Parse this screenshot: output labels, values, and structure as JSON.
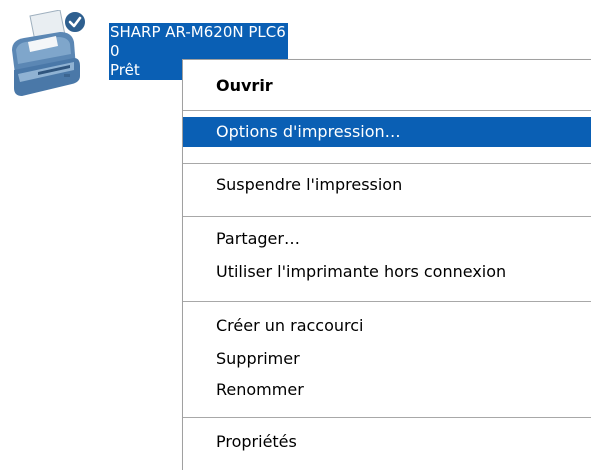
{
  "printer": {
    "name": "SHARP AR-M620N PLC6",
    "jobs": "0",
    "status": "Prêt",
    "default_badge_icon": "checkmark-badge-icon",
    "icon": "printer-icon"
  },
  "context_menu": {
    "items": [
      {
        "label": "Ouvrir",
        "bold": true
      },
      {
        "label": "Options d'impression…",
        "selected": true
      },
      {
        "label": "Suspendre l'impression"
      },
      {
        "label": "Partager…"
      },
      {
        "label": "Utiliser l'imprimante hors connexion"
      },
      {
        "label": "Créer un raccourci"
      },
      {
        "label": "Supprimer"
      },
      {
        "label": "Renommer"
      },
      {
        "label": "Propriétés"
      }
    ]
  },
  "colors": {
    "selection": "#0a5fb4",
    "separator": "#a8a8a8",
    "menu_border": "#a0a0a0"
  }
}
